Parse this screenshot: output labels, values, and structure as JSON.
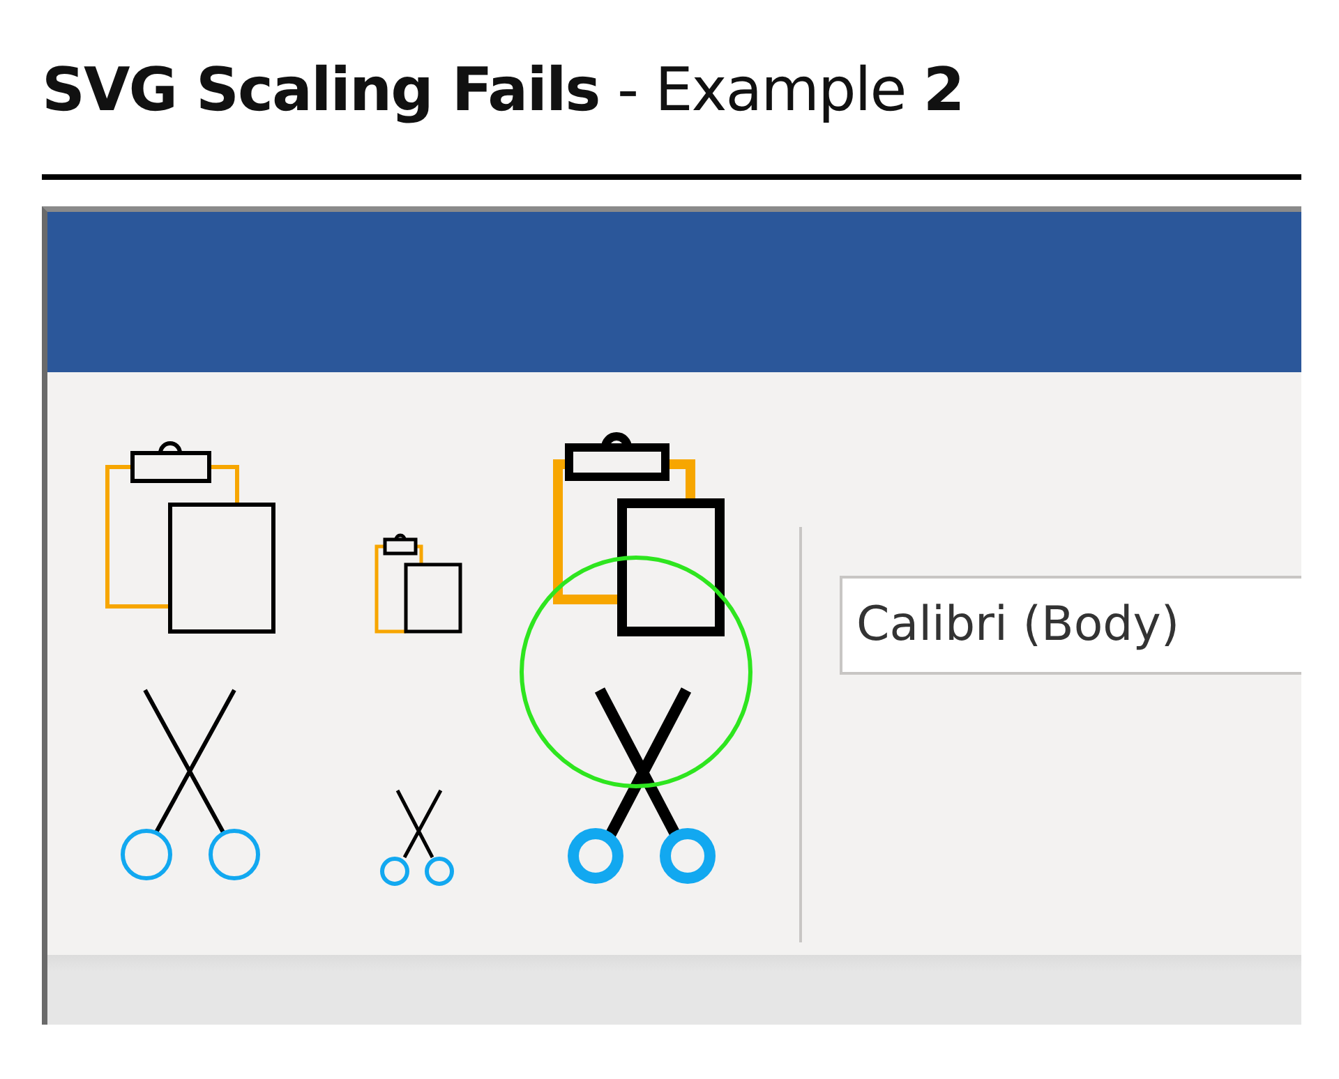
{
  "title": "**SVG Scaling Fails** - Example **2**",
  "font_box": {
    "value": "Calibri (Body)"
  }
}
